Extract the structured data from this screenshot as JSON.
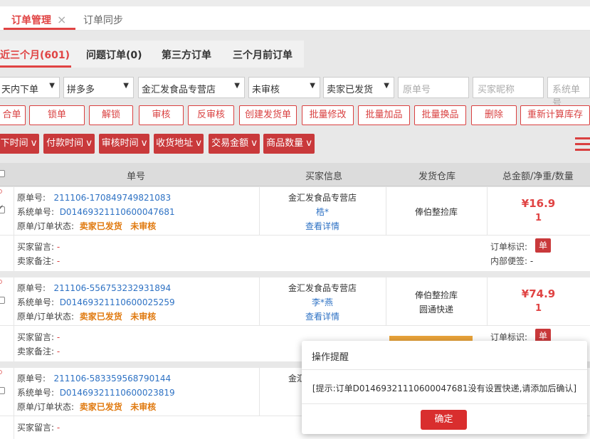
{
  "tabs": {
    "active_label": "订单管理",
    "close_icon": "×",
    "inactive_label": "订单同步"
  },
  "subtabs": [
    {
      "label": "近三个月(601)"
    },
    {
      "label": "问题订单(0)"
    },
    {
      "label": "第三方订单"
    },
    {
      "label": "三个月前订单"
    }
  ],
  "filters": {
    "order_time": "天内下单",
    "platform": "拼多多",
    "shop": "金汇发食品专营店",
    "review_status": "未审核",
    "ship_status": "卖家已发货",
    "original_no_placeholder": "原单号",
    "buyer_nick_placeholder": "买家昵称",
    "system_no_placeholder": "系统单号"
  },
  "actions": [
    "合单",
    "锁单",
    "解锁",
    "审核",
    "反审核",
    "创建发货单",
    "批量修改",
    "批量加品",
    "批量换品",
    "删除",
    "重新计算库存"
  ],
  "sorts": [
    "下时间 v",
    "付款时间 v",
    "审核时间 v",
    "收货地址 v",
    "交易金额 v",
    "商品数量 v"
  ],
  "table": {
    "headers": {
      "order_no": "单号",
      "buyer": "买家信息",
      "warehouse": "发货仓库",
      "total": "总金额/净重/数量"
    }
  },
  "labels": {
    "original_no": "原单号:",
    "system_no": "系统单号:",
    "status": "原单/订单状态:",
    "buyer_msg": "买家留言:",
    "seller_note": "卖家备注:",
    "order_mark": "订单标识:",
    "inner_note": "内部便签:",
    "view_detail": "查看详情"
  },
  "orders": [
    {
      "original_no": "211106-170849749821083",
      "system_no": "D0146932111060004768 1",
      "system_no_full": "D01469321110600047681",
      "ship_status": "卖家已发货",
      "review_status": "未审核",
      "shop": "金汇发食品专营店",
      "buyer": "梏*",
      "warehouse": "俸伯整捡库",
      "courier": "",
      "price": "¥16.9",
      "qty": "1",
      "buyer_msg": "-",
      "seller_note": "-",
      "mark": "单",
      "inner_note": "-"
    },
    {
      "original_no": "211106-556753232931894",
      "system_no_full": "D01469321110600025259",
      "ship_status": "卖家已发货",
      "review_status": "未审核",
      "shop": "金汇发食品专营店",
      "buyer": "李*燕",
      "warehouse": "俸伯整捡库",
      "courier": "圆通快递",
      "price": "¥74.9",
      "qty": "1",
      "buyer_msg": "-",
      "seller_note": "-",
      "mark": "单"
    },
    {
      "original_no": "211106-583359568790144",
      "system_no_full": "D01469321110600023819",
      "ship_status": "卖家已发货",
      "review_status": "未审核",
      "shop": "金汇",
      "buyer_msg": "-"
    }
  ],
  "modal": {
    "title": "操作提醒",
    "message": "[提示:订单D01469321110600047681没有设置快递,请添加后确认]",
    "confirm": "确定"
  },
  "colors": {
    "accent": "#e04343",
    "button_fill": "#c9393b",
    "link": "#2e72c4",
    "status_orange": "#e07a10"
  }
}
